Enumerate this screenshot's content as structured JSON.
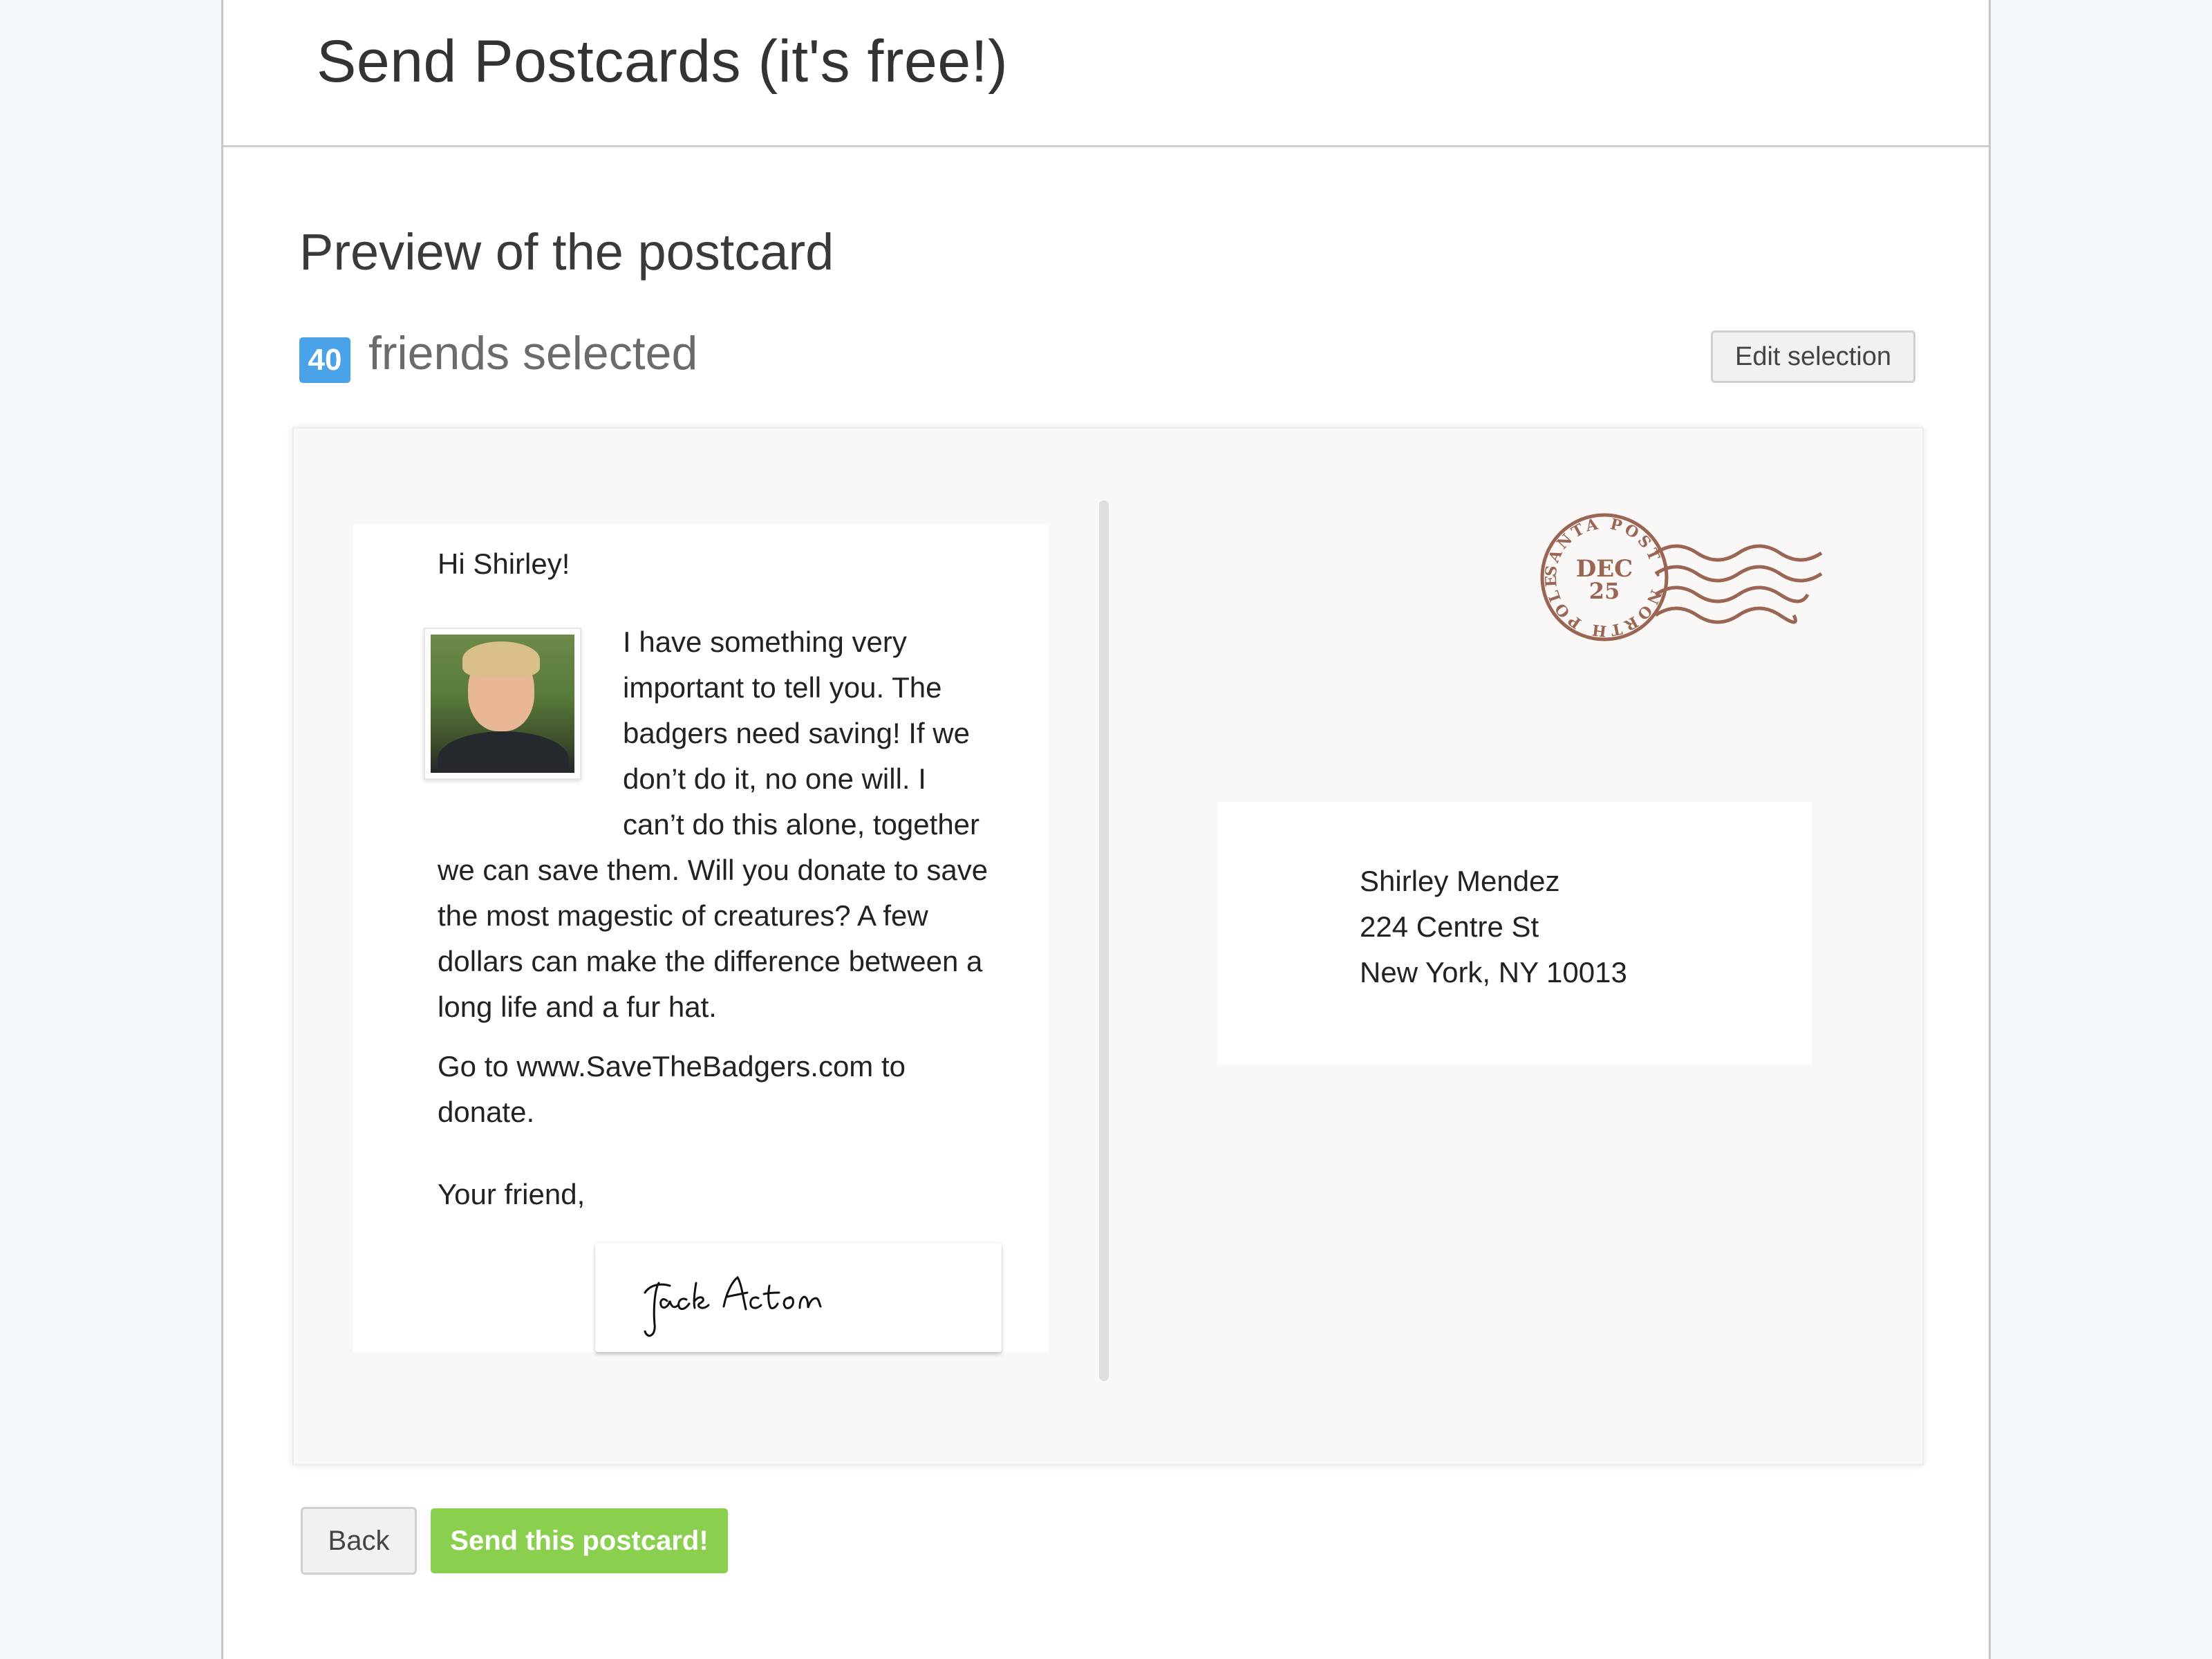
{
  "header": {
    "title": "Send Postcards (it's free!)"
  },
  "preview": {
    "heading": "Preview of the postcard",
    "friends_count": "40",
    "friends_label": "friends selected",
    "edit_button": "Edit selection"
  },
  "postcard": {
    "greeting": "Hi Shirley!",
    "message": "I have something very important to tell you. The badgers need saving! If we don’t do it, no one will. I can’t do this alone, together we can save them. Will you donate to save the most magestic of creatures? A few dollars can make the difference between a long life and a fur hat.",
    "call_to_action": "Go to www.SaveTheBadgers.com to donate.",
    "closing": "Your friend,",
    "signature": "Jack Acton",
    "stamp": {
      "month": "DEC",
      "day": "25",
      "ring_text": "SANTA POST · NORTH POLE"
    },
    "address": {
      "name": "Shirley Mendez",
      "street": "224 Centre St",
      "city_line": "New York, NY 10013"
    }
  },
  "actions": {
    "back": "Back",
    "send": "Send this postcard!"
  },
  "colors": {
    "badge": "#4aa3e8",
    "send_button": "#8bcf4f",
    "stamp_ink": "#9a6553"
  }
}
